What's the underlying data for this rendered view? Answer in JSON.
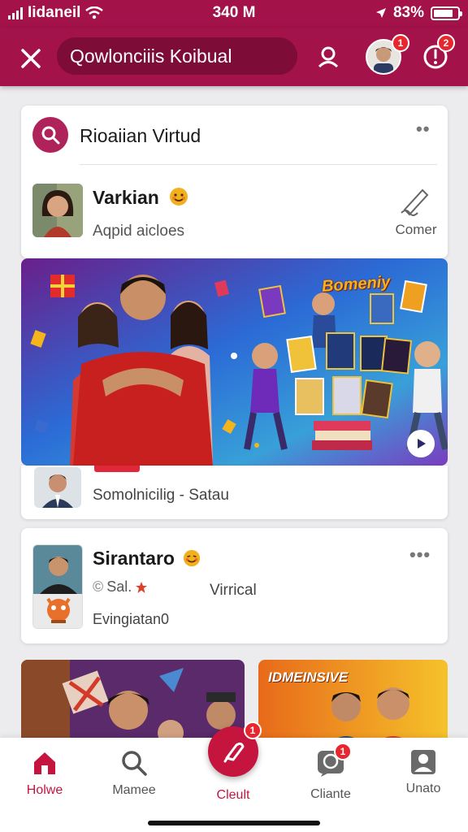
{
  "status_bar": {
    "carrier": "Iidaneil",
    "time": "340 M",
    "battery": "83%",
    "battery_level": 0.83
  },
  "header": {
    "search_text": "Qowlonciiis Koibual",
    "avatar_badge": "1",
    "alert_badge": "2"
  },
  "card_search": {
    "title": "Rioaiian Virtud"
  },
  "card_profile": {
    "name": "Varkian",
    "subtitle": "Aqpid aicloes",
    "action_label": "Comer"
  },
  "banner": {
    "title": "Bomeniy"
  },
  "card_news": {
    "caption": "Somolnicilig - Satau"
  },
  "card_post": {
    "name": "Sirantaro",
    "tag": "Sal.",
    "side_label": "Virrical",
    "subtitle": "Evingiatan0"
  },
  "tile_right": {
    "title": "IDMEINSIVE"
  },
  "tabs": [
    {
      "label": "Holwe",
      "icon": "home-icon",
      "active": true
    },
    {
      "label": "Mamee",
      "icon": "search-icon",
      "active": false
    },
    {
      "label": "Cleult",
      "icon": "create-icon",
      "active": false,
      "badge": "1"
    },
    {
      "label": "Cliante",
      "icon": "chat-icon",
      "active": false,
      "badge": "1"
    },
    {
      "label": "Unato",
      "icon": "profile-icon",
      "active": false
    }
  ],
  "colors": {
    "brand": "#a4124a",
    "accent": "#c5153e",
    "badge": "#e8262e"
  }
}
